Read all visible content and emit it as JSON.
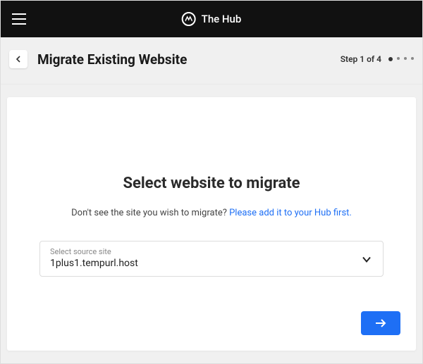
{
  "header": {
    "app_name": "The Hub"
  },
  "page": {
    "title": "Migrate Existing Website",
    "step_label": "Step 1 of 4",
    "current_step": 1,
    "total_steps": 4
  },
  "main": {
    "heading": "Select website to migrate",
    "helper_prefix": "Don't see the site you wish to migrate? ",
    "helper_link": "Please add it to your Hub first."
  },
  "select": {
    "label": "Select source site",
    "value": "1plus1.tempurl.host"
  },
  "icons": {
    "menu": "menu-icon",
    "back": "chevron-left-icon",
    "dropdown": "chevron-down-icon",
    "next": "arrow-right-icon",
    "logo": "hub-logo-icon"
  }
}
